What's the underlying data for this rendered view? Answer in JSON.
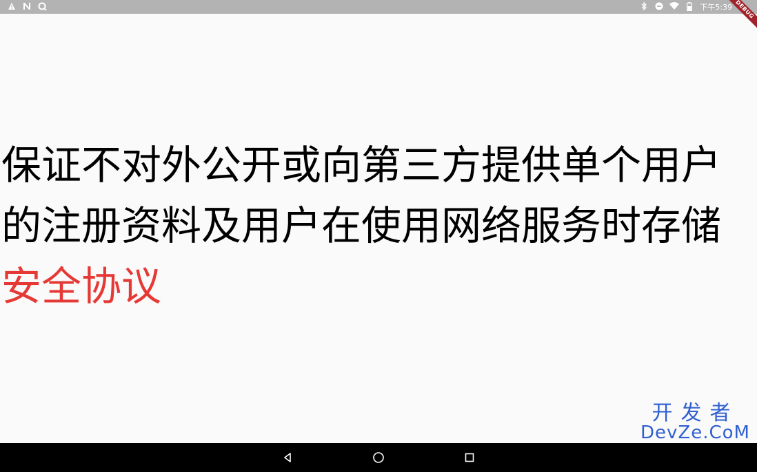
{
  "status_bar": {
    "left_icons": [
      "warning-icon",
      "n-icon",
      "search-app-icon"
    ],
    "right_icons": [
      "bluetooth-icon",
      "dnd-icon",
      "wifi-icon",
      "battery-icon"
    ],
    "clock": "下午5:39"
  },
  "debug_banner": "DEBUG",
  "content": {
    "paragraph_text": "保证不对外公开或向第三方提供单个用户的注册资料及用户在使用网络服务时存储",
    "link_text": "安全协议",
    "link_color": "#e53935",
    "text_color": "#000000"
  },
  "watermark": {
    "line1": "开发者",
    "line2": "DevZe.CoM"
  },
  "nav_bar": {
    "buttons": [
      "back-icon",
      "home-icon",
      "recents-icon"
    ]
  }
}
